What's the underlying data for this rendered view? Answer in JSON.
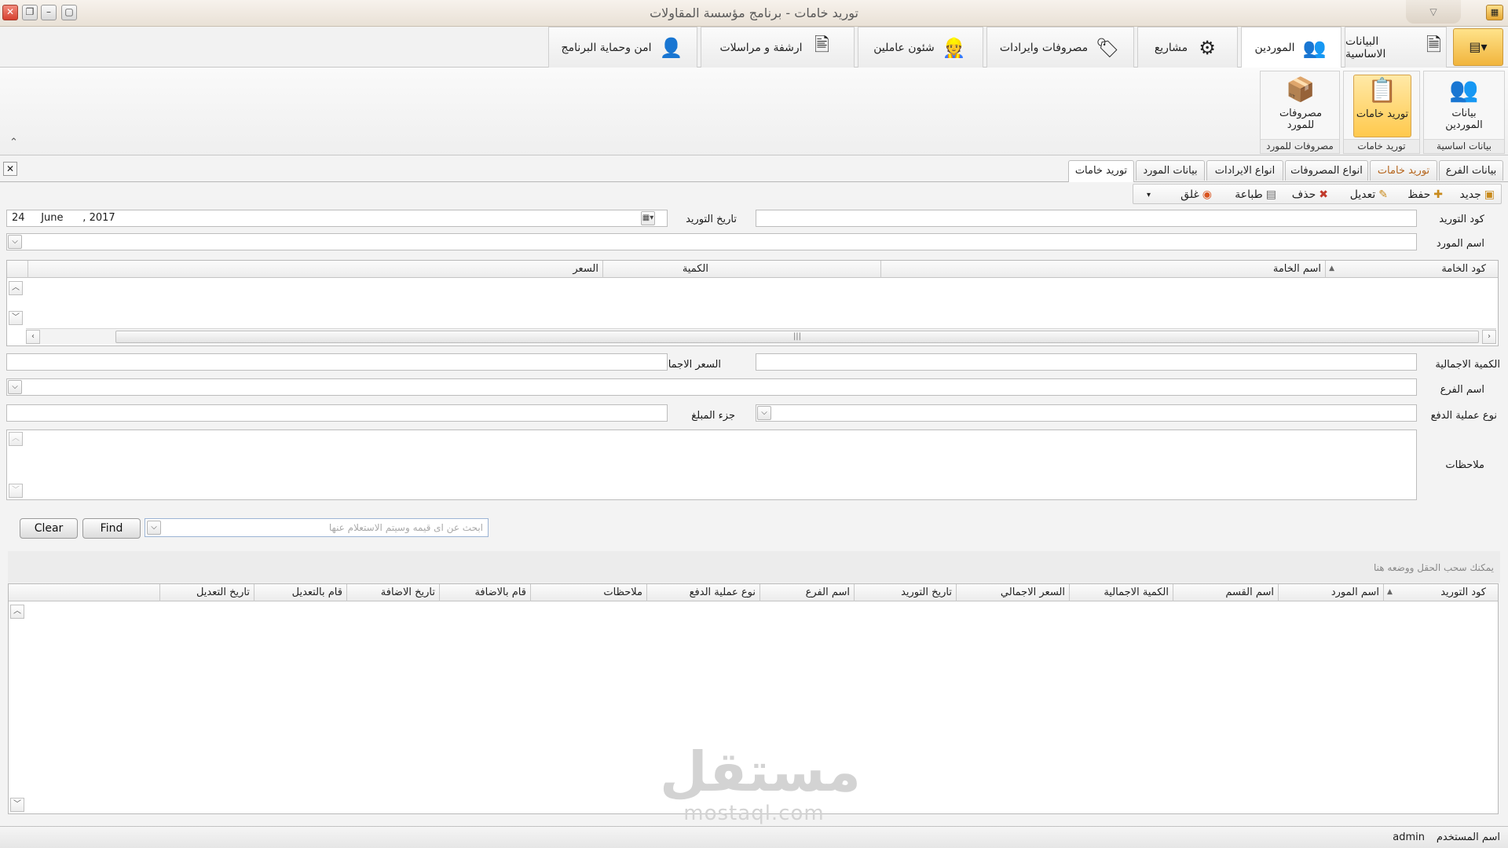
{
  "window": {
    "title": "توريد خامات - برنامج مؤسسة المقاولات",
    "buttons": [
      "✕",
      "❐",
      "–",
      "▢"
    ]
  },
  "ribbon_tabs": [
    {
      "label": "البيانات الاساسية",
      "icon": "document-icon"
    },
    {
      "label": "الموردين",
      "icon": "suppliers-icon",
      "active": true
    },
    {
      "label": "مشاريع",
      "icon": "projects-icon"
    },
    {
      "label": "مصروفات وايرادات",
      "icon": "money-tag-icon"
    },
    {
      "label": "شئون عاملين",
      "icon": "worker-icon"
    },
    {
      "label": "ارشفة و مراسلات",
      "icon": "archive-icon"
    },
    {
      "label": "امن وحماية البرنامج",
      "icon": "security-user-icon"
    }
  ],
  "ribbon_groups": [
    {
      "label": "بيانات اساسية",
      "button": "بيانات الموردين"
    },
    {
      "label": "توريد خامات",
      "button": "توريد خامات",
      "active": true
    },
    {
      "label": "مصروفات للمورد",
      "button": "مصروفات للمورد"
    }
  ],
  "doc_tabs": [
    "بيانات الفرع",
    "توريد خامات",
    "انواع المصروفات",
    "انواع الايرادات",
    "بيانات المورد",
    "توريد خامات"
  ],
  "toolbar": {
    "new": "جديد",
    "save": "حفظ",
    "edit": "تعديل",
    "delete": "حذف",
    "print": "طباعة",
    "close": "غلق"
  },
  "form": {
    "supply_code_label": "كود التوريد",
    "supply_code_value": "",
    "supply_date_label": "تاريخ التوريد",
    "supply_date_value": "24     June      , 2017",
    "supplier_name_label": "اسم  المورد",
    "total_qty_label": "الكمية الاجمالية",
    "total_price_label": "السعر الاجمالي",
    "branch_label": "اسم الفرع",
    "payment_type_label": "نوع عملية الدفع",
    "amount_part_label": "جزء المبلغ",
    "notes_label": "ملاحظات"
  },
  "items_grid": {
    "columns": [
      "كود الخامة",
      "اسم الخامة",
      "الكمية",
      "السعر"
    ]
  },
  "search": {
    "placeholder": "ابحث عن اى قيمه وسيتم الاستعلام عنها",
    "find": "Find",
    "clear": "Clear",
    "drag_hint": "يمكنك سحب الحقل ووضعه هنا"
  },
  "results_grid": {
    "columns": [
      "كود التوريد",
      "اسم المورد",
      "اسم القسم",
      "الكمية الاجمالية",
      "السعر الاجمالي",
      "تاريخ التوريد",
      "اسم الفرع",
      "نوع عملية الدفع",
      "ملاحظات",
      "قام بالاضافة",
      "تاريخ الاضافة",
      "قام بالتعديل",
      "تاريخ التعديل"
    ]
  },
  "status": {
    "user_label": "اسم المستخدم",
    "user_value": "admin"
  },
  "watermark": {
    "arabic": "مستقل",
    "latin": "mostaql.com"
  }
}
